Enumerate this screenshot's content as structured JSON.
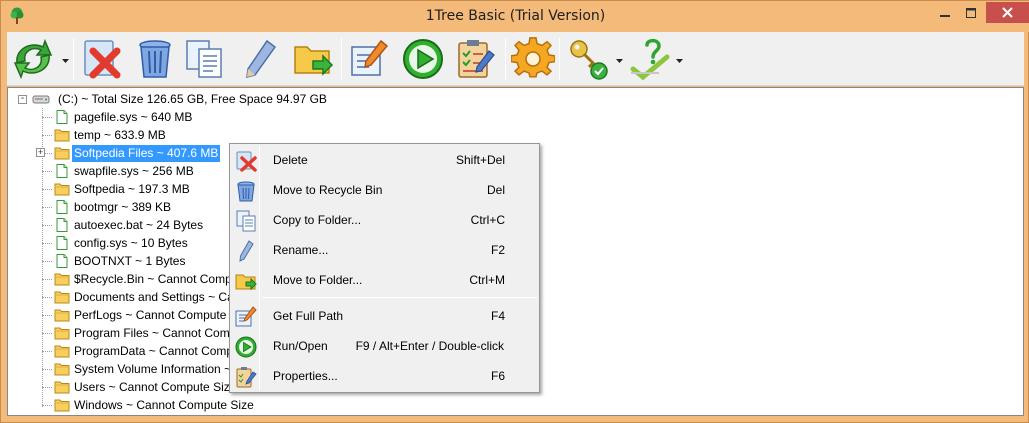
{
  "window": {
    "title": "1Tree Basic (Trial Version)"
  },
  "toolbar": {
    "buttons": [
      {
        "name": "refresh",
        "icon": "refresh-arrows-icon",
        "has_dropdown": true
      },
      {
        "name": "delete",
        "icon": "delete-x-icon"
      },
      {
        "name": "recycle",
        "icon": "recycle-bin-icon"
      },
      {
        "name": "copy",
        "icon": "copy-pages-icon"
      },
      {
        "name": "rename",
        "icon": "pencil-icon"
      },
      {
        "name": "move",
        "icon": "folder-move-icon"
      },
      {
        "name": "full-path",
        "icon": "edit-document-icon"
      },
      {
        "name": "run",
        "icon": "play-icon"
      },
      {
        "name": "properties",
        "icon": "clipboard-checklist-icon"
      },
      {
        "name": "settings",
        "icon": "gear-icon"
      },
      {
        "name": "register",
        "icon": "keys-icon",
        "has_dropdown": true
      },
      {
        "name": "help",
        "icon": "help-check-icon",
        "has_dropdown": true
      }
    ]
  },
  "tree": {
    "root": "(C:) ~ Total Size 126.65 GB, Free Space 94.97 GB",
    "items": [
      {
        "label": "pagefile.sys ~ 640 MB",
        "type": "file"
      },
      {
        "label": "temp ~ 633.9 MB",
        "type": "folder"
      },
      {
        "label": "Softpedia Files ~ 407.6 MB",
        "type": "folder",
        "selected": true,
        "expandable": true
      },
      {
        "label": "swapfile.sys ~ 256 MB",
        "type": "file"
      },
      {
        "label": "Softpedia ~ 197.3 MB",
        "type": "folder"
      },
      {
        "label": "bootmgr ~ 389 KB",
        "type": "file"
      },
      {
        "label": "autoexec.bat ~ 24 Bytes",
        "type": "file"
      },
      {
        "label": "config.sys ~ 10 Bytes",
        "type": "file"
      },
      {
        "label": "BOOTNXT ~ 1 Bytes",
        "type": "file"
      },
      {
        "label": "$Recycle.Bin ~ Cannot Compute Size",
        "type": "folder"
      },
      {
        "label": "Documents and Settings ~ Cannot Compute Size",
        "type": "folder"
      },
      {
        "label": "PerfLogs ~ Cannot Compute Size",
        "type": "folder"
      },
      {
        "label": "Program Files ~ Cannot Compute Size",
        "type": "folder"
      },
      {
        "label": "ProgramData ~ Cannot Compute Size",
        "type": "folder"
      },
      {
        "label": "System Volume Information ~ Cannot Compute Size",
        "type": "folder"
      },
      {
        "label": "Users ~ Cannot Compute Size",
        "type": "folder"
      },
      {
        "label": "Windows ~ Cannot Compute Size",
        "type": "folder"
      }
    ]
  },
  "context_menu": {
    "items": [
      {
        "label": "Delete",
        "shortcut": "Shift+Del",
        "icon": "delete-x-icon"
      },
      {
        "label": "Move to Recycle Bin",
        "shortcut": "Del",
        "icon": "recycle-bin-icon"
      },
      {
        "label": "Copy to Folder...",
        "shortcut": "Ctrl+C",
        "icon": "copy-pages-icon"
      },
      {
        "label": "Rename...",
        "shortcut": "F2",
        "icon": "pencil-icon"
      },
      {
        "label": "Move to Folder...",
        "shortcut": "Ctrl+M",
        "icon": "folder-move-icon"
      },
      {
        "label": "Get Full Path",
        "shortcut": "F4",
        "icon": "edit-document-icon"
      },
      {
        "label": "Run/Open",
        "shortcut": "F9 / Alt+Enter / Double-click",
        "icon": "play-icon"
      },
      {
        "label": "Properties...",
        "shortcut": "F6",
        "icon": "clipboard-checklist-icon"
      }
    ]
  },
  "colors": {
    "frame": "#f3ba7a",
    "selection": "#3399ff",
    "close": "#c7504c",
    "menu_bg": "#f0f0f0"
  }
}
